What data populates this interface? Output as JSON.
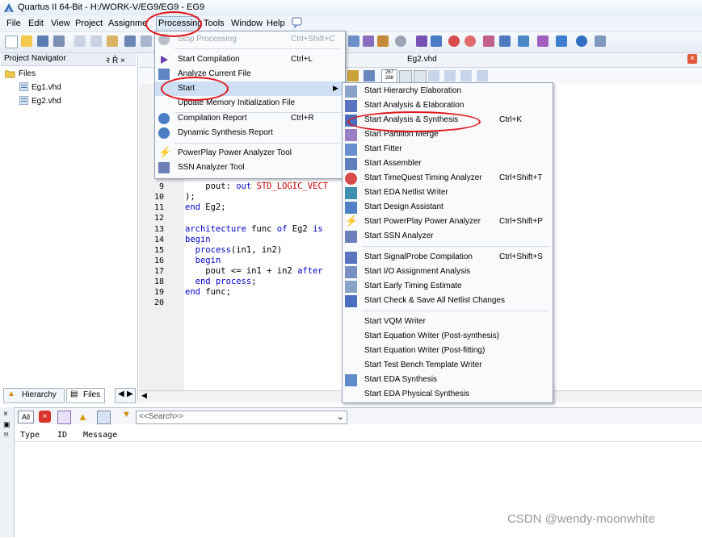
{
  "window": {
    "title": "Quartus II 64-Bit - H:/WORK-V/EG9/EG9 - EG9"
  },
  "menubar": [
    "File",
    "Edit",
    "View",
    "Project",
    "Assignments",
    "Processing",
    "Tools",
    "Window",
    "Help"
  ],
  "navigator": {
    "title": "Project Navigator",
    "pin_label": "२ Ř ×",
    "root": "Files",
    "files": [
      "Eg1.vhd",
      "Eg2.vhd"
    ],
    "tabs": [
      "Hierarchy",
      "Files"
    ]
  },
  "editor": {
    "tab_title": "Eg2.vhd",
    "toolbar_badge": "267\n268",
    "lines": [
      {
        "n": "9",
        "text": "    pout: out STD_LOGIC_VECT"
      },
      {
        "n": "10",
        "text": ");"
      },
      {
        "n": "11",
        "text": "end Eg2;"
      },
      {
        "n": "12",
        "text": ""
      },
      {
        "n": "13",
        "text": "architecture func of Eg2 is"
      },
      {
        "n": "14",
        "text": "begin"
      },
      {
        "n": "15",
        "text": "  process(in1, in2)"
      },
      {
        "n": "16",
        "text": "  begin"
      },
      {
        "n": "17",
        "text": "    pout <= in1 + in2 after"
      },
      {
        "n": "18",
        "text": "  end process;"
      },
      {
        "n": "19",
        "text": "end func;"
      },
      {
        "n": "20",
        "text": ""
      }
    ]
  },
  "processing_menu": {
    "items": [
      {
        "label": "Stop Processing",
        "shortcut": "Ctrl+Shift+C",
        "disabled": true,
        "icon": "stop-icon"
      },
      {
        "label": "Start Compilation",
        "shortcut": "Ctrl+L",
        "icon": "play-icon"
      },
      {
        "label": "Analyze Current File",
        "shortcut": "",
        "icon": "analyze-icon"
      },
      {
        "label": "Start",
        "shortcut": "",
        "submenu": true,
        "icon": ""
      },
      {
        "label": "Update Memory Initialization File",
        "shortcut": "",
        "icon": ""
      },
      {
        "label": "Compilation Report",
        "shortcut": "Ctrl+R",
        "icon": "report-icon"
      },
      {
        "label": "Dynamic Synthesis Report",
        "shortcut": "",
        "icon": "report-icon"
      },
      {
        "label": "PowerPlay Power Analyzer Tool",
        "shortcut": "",
        "icon": "lightning-icon"
      },
      {
        "label": "SSN Analyzer Tool",
        "shortcut": "",
        "icon": "ssn-icon"
      }
    ]
  },
  "start_submenu": {
    "items": [
      {
        "label": "Start Hierarchy Elaboration",
        "shortcut": ""
      },
      {
        "label": "Start Analysis & Elaboration",
        "shortcut": ""
      },
      {
        "label": "Start Analysis & Synthesis",
        "shortcut": "Ctrl+K"
      },
      {
        "label": "Start Partition Merge",
        "shortcut": ""
      },
      {
        "label": "Start Fitter",
        "shortcut": ""
      },
      {
        "label": "Start Assembler",
        "shortcut": ""
      },
      {
        "label": "Start TimeQuest Timing Analyzer",
        "shortcut": "Ctrl+Shift+T"
      },
      {
        "label": "Start EDA Netlist Writer",
        "shortcut": ""
      },
      {
        "label": "Start Design Assistant",
        "shortcut": ""
      },
      {
        "label": "Start PowerPlay Power Analyzer",
        "shortcut": "Ctrl+Shift+P"
      },
      {
        "label": "Start SSN Analyzer",
        "shortcut": ""
      },
      {
        "label": "Start SignalProbe Compilation",
        "shortcut": "Ctrl+Shift+S"
      },
      {
        "label": "Start I/O Assignment Analysis",
        "shortcut": ""
      },
      {
        "label": "Start Early Timing Estimate",
        "shortcut": ""
      },
      {
        "label": "Start Check & Save All Netlist Changes",
        "shortcut": ""
      },
      {
        "label": "Start VQM Writer",
        "shortcut": ""
      },
      {
        "label": "Start Equation Writer (Post-synthesis)",
        "shortcut": ""
      },
      {
        "label": "Start Equation Writer (Post-fitting)",
        "shortcut": ""
      },
      {
        "label": "Start Test Bench Template Writer",
        "shortcut": ""
      },
      {
        "label": "Start EDA Synthesis",
        "shortcut": ""
      },
      {
        "label": "Start EDA Physical Synthesis",
        "shortcut": ""
      }
    ]
  },
  "messages": {
    "filter_all": "All",
    "search_placeholder": "<<Search>>",
    "columns": [
      "Type",
      "ID",
      "Message"
    ]
  },
  "watermark": "CSDN @wendy-moonwhite",
  "colors": {
    "annotation_red": "#e0161b",
    "menu_bg": "#f9fafc",
    "keyword_blue": "#0000cc"
  }
}
